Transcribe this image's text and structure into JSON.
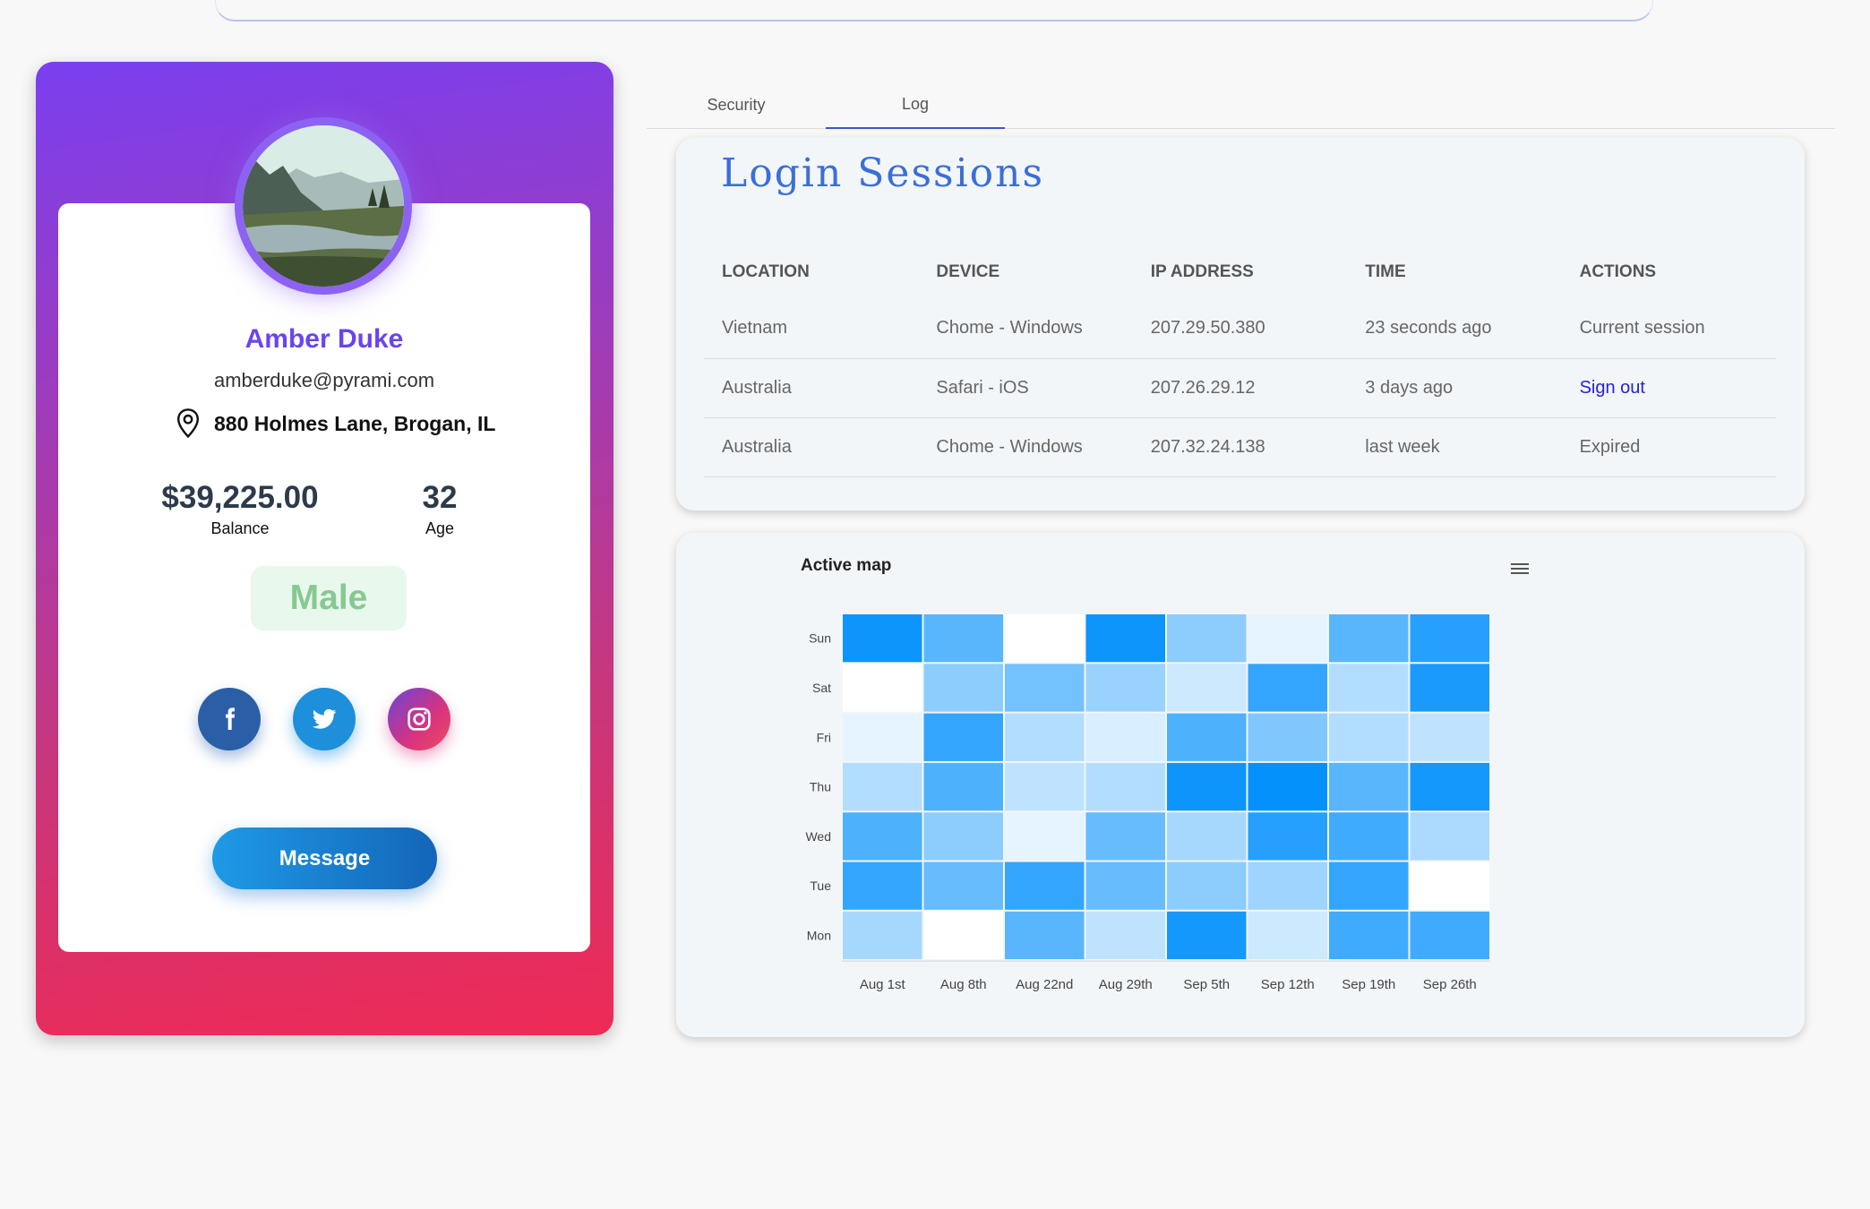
{
  "profile": {
    "name": "Amber Duke",
    "email": "amberduke@pyrami.com",
    "address": "880 Holmes Lane, Brogan, IL",
    "balance": "$39,225.00",
    "balance_label": "Balance",
    "age": "32",
    "age_label": "Age",
    "gender": "Male",
    "message_label": "Message",
    "socials": [
      "facebook-icon",
      "twitter-icon",
      "instagram-icon"
    ]
  },
  "tabs": [
    {
      "label": "Security",
      "active": false
    },
    {
      "label": "Log",
      "active": true
    }
  ],
  "sessions": {
    "title": "Login Sessions",
    "columns": [
      "LOCATION",
      "DEVICE",
      "IP ADDRESS",
      "TIME",
      "ACTIONS"
    ],
    "rows": [
      {
        "location": "Vietnam",
        "device": "Chome - Windows",
        "ip": "207.29.50.380",
        "time": "23 seconds ago",
        "action": "Current session"
      },
      {
        "location": "Australia",
        "device": "Safari - iOS",
        "ip": "207.26.29.12",
        "time": "3 days ago",
        "action": "Sign out"
      },
      {
        "location": "Australia",
        "device": "Chome - Windows",
        "ip": "207.32.24.138",
        "time": "last week",
        "action": "Expired"
      }
    ]
  },
  "active_map": {
    "title": "Active map",
    "menu_icon": "hamburger-menu-icon"
  },
  "chart_data": {
    "type": "heatmap",
    "title": "Active map",
    "x": [
      "Aug 1st",
      "Aug 8th",
      "Aug 22nd",
      "Aug 29th",
      "Sep 5th",
      "Sep 12th",
      "Sep 19th",
      "Sep 26th"
    ],
    "y": [
      "Sun",
      "Sat",
      "Fri",
      "Thu",
      "Wed",
      "Tue",
      "Mon"
    ],
    "values": [
      [
        95,
        65,
        0,
        95,
        45,
        10,
        65,
        85
      ],
      [
        0,
        45,
        55,
        40,
        20,
        80,
        30,
        90
      ],
      [
        10,
        80,
        30,
        15,
        70,
        50,
        30,
        25
      ],
      [
        30,
        70,
        25,
        30,
        95,
        98,
        65,
        92
      ],
      [
        70,
        45,
        10,
        60,
        35,
        85,
        75,
        33
      ],
      [
        80,
        60,
        80,
        60,
        45,
        38,
        80,
        0
      ],
      [
        35,
        0,
        65,
        25,
        92,
        20,
        75,
        75
      ]
    ],
    "color_low": "#ffffff",
    "color_high": "#008ffb"
  }
}
